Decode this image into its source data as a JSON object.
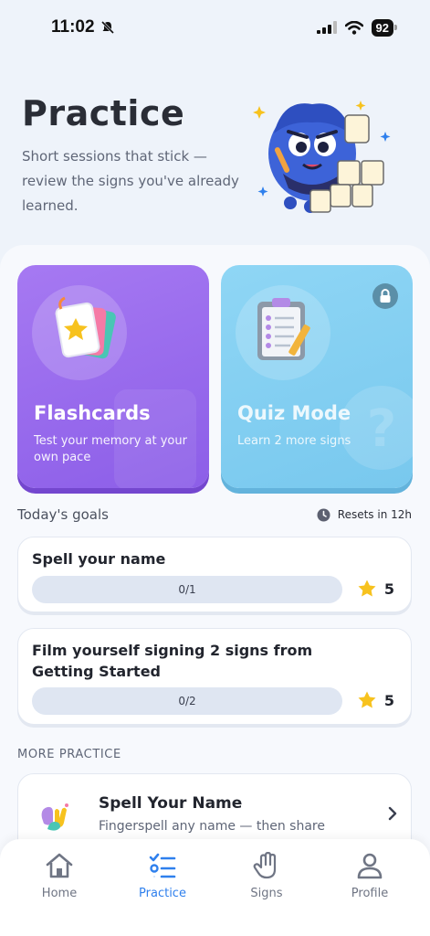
{
  "status_bar": {
    "time": "11:02",
    "battery": "92"
  },
  "hero": {
    "title": "Practice",
    "subtitle": "Short sessions that stick — review the signs you've already learned."
  },
  "modes": [
    {
      "title": "Flashcards",
      "description": "Test your memory at your own pace",
      "locked": false,
      "color": "#9b6cf0"
    },
    {
      "title": "Quiz Mode",
      "description": "Learn 2 more signs",
      "locked": true,
      "color": "#82cff2"
    }
  ],
  "goals": {
    "title": "Today's goals",
    "reset_label": "Resets in 12h",
    "items": [
      {
        "title": "Spell your name",
        "progress": "0/1",
        "reward": "5"
      },
      {
        "title": "Film yourself signing 2 signs from Getting Started",
        "progress": "0/2",
        "reward": "5"
      }
    ]
  },
  "more_practice": {
    "title": "MORE PRACTICE",
    "items": [
      {
        "name": "Spell Your Name",
        "description": "Fingerspell any name — then share"
      }
    ]
  },
  "tabs": [
    {
      "label": "Home",
      "icon": "home-icon"
    },
    {
      "label": "Practice",
      "icon": "list-icon",
      "active": true
    },
    {
      "label": "Signs",
      "icon": "hand-icon"
    },
    {
      "label": "Profile",
      "icon": "person-icon"
    }
  ],
  "colors": {
    "accent": "#2f80ed",
    "star": "#f7c21e"
  }
}
